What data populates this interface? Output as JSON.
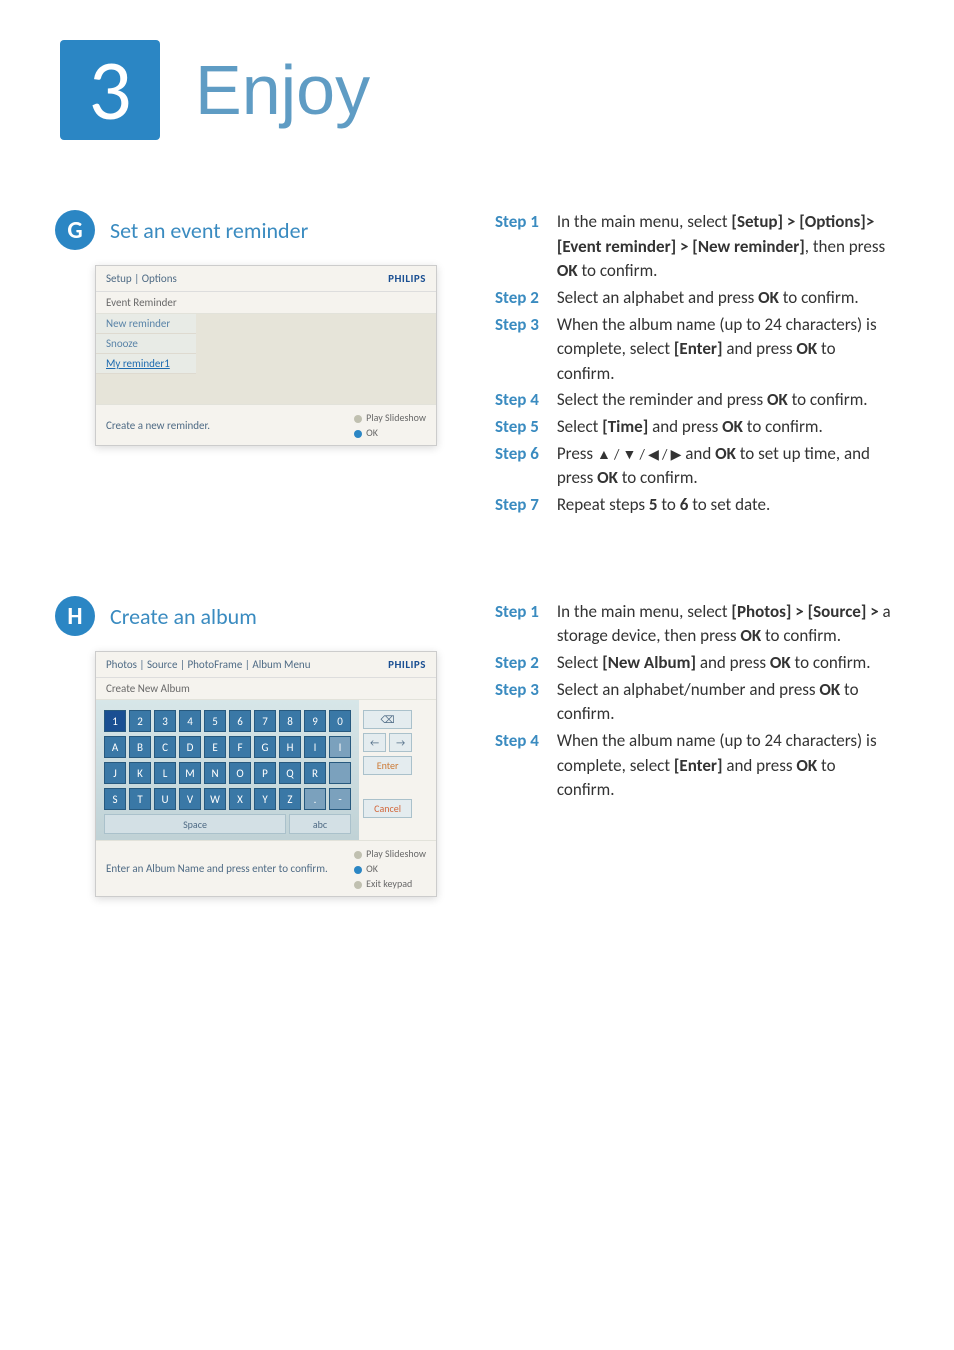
{
  "chapter": {
    "number": "3",
    "title": "Enjoy"
  },
  "sectionG": {
    "letter": "G",
    "title": "Set an event reminder",
    "device": {
      "breadcrumb": "Setup | Options",
      "brand": "PHILIPS",
      "subbar": "Event Reminder",
      "menu": [
        "New reminder",
        "Snooze",
        "My reminder1"
      ],
      "bottomHint": "Create a new reminder.",
      "action1": "Play Slideshow",
      "action2": "OK"
    }
  },
  "sectionH": {
    "letter": "H",
    "title": "Create an album",
    "device": {
      "breadcrumb": "Photos | Source | PhotoFrame | Album Menu",
      "brand": "PHILIPS",
      "subbar": "Create New Album",
      "rows": [
        [
          "1",
          "2",
          "3",
          "4",
          "5",
          "6",
          "7",
          "8",
          "9",
          "0"
        ],
        [
          "A",
          "B",
          "C",
          "D",
          "E",
          "F",
          "G",
          "H",
          "I",
          "I"
        ],
        [
          "J",
          "K",
          "L",
          "M",
          "N",
          "O",
          "P",
          "Q",
          "R",
          " "
        ],
        [
          "S",
          "T",
          "U",
          "V",
          "W",
          "X",
          "Y",
          "Z",
          ".",
          "-"
        ]
      ],
      "side": {
        "back": "⌫",
        "left": "←",
        "right": "→",
        "enter": "Enter",
        "cancel": "Cancel"
      },
      "space": "Space",
      "abc": "abc",
      "bottomHint": "Enter an Album Name and press enter to confirm.",
      "action1": "Play Slideshow",
      "action2": "OK",
      "action3": "Exit keypad"
    }
  },
  "stepsTop": {
    "s1": {
      "label": "Step 1",
      "a": "In the main menu, select ",
      "b": "[Setup] > [Options]>[Event reminder] > [New reminder]",
      "c": ", then press ",
      "d": "OK",
      "e": " to confirm."
    },
    "s2": {
      "label": "Step 2",
      "a": "Select an alphabet and press ",
      "b": "OK",
      "c": " to confirm."
    },
    "s3": {
      "label": "Step 3",
      "a": " When the album name (up to 24 characters) is complete, select ",
      "b": "[Enter]",
      "c": " and press ",
      "d": "OK",
      "e": " to confirm."
    },
    "s4": {
      "label": "Step 4",
      "a": "Select the reminder and press ",
      "b": "OK",
      "c": " to confirm."
    },
    "s5": {
      "label": "Step 5",
      "a": "Select ",
      "b": "[Time]",
      "c": " and press ",
      "d": "OK",
      "e": " to confirm."
    },
    "s6": {
      "label": "Step 6",
      "a": "Press ",
      "arrows": "▲ / ▼ / ◀ / ▶",
      "b": " and ",
      "c": "OK",
      "d": " to set up time, and press ",
      "e": "OK",
      "f": " to confirm."
    },
    "s7": {
      "label": "Step 7",
      "a": "Repeat steps ",
      "b": "5",
      "c": " to ",
      "d": "6",
      "e": " to set date."
    }
  },
  "stepsBottom": {
    "s1": {
      "label": "Step 1",
      "a": "In the main menu, select ",
      "b": "[Photos] > [Source] >",
      "c": " a storage device, then press ",
      "d": "OK",
      "e": " to confirm."
    },
    "s2": {
      "label": "Step 2",
      "a": "Select ",
      "b": "[New Album]",
      "c": " and press ",
      "d": "OK",
      "e": " to confirm."
    },
    "s3": {
      "label": "Step 3",
      "a": "Select an alphabet/number and press ",
      "b": "OK",
      "c": " to confirm."
    },
    "s4": {
      "label": "Step 4",
      "a": " When the album name (up to 24 characters) is complete, select ",
      "b": "[Enter]",
      "c": " and press ",
      "d": "OK",
      "e": " to confirm."
    }
  }
}
